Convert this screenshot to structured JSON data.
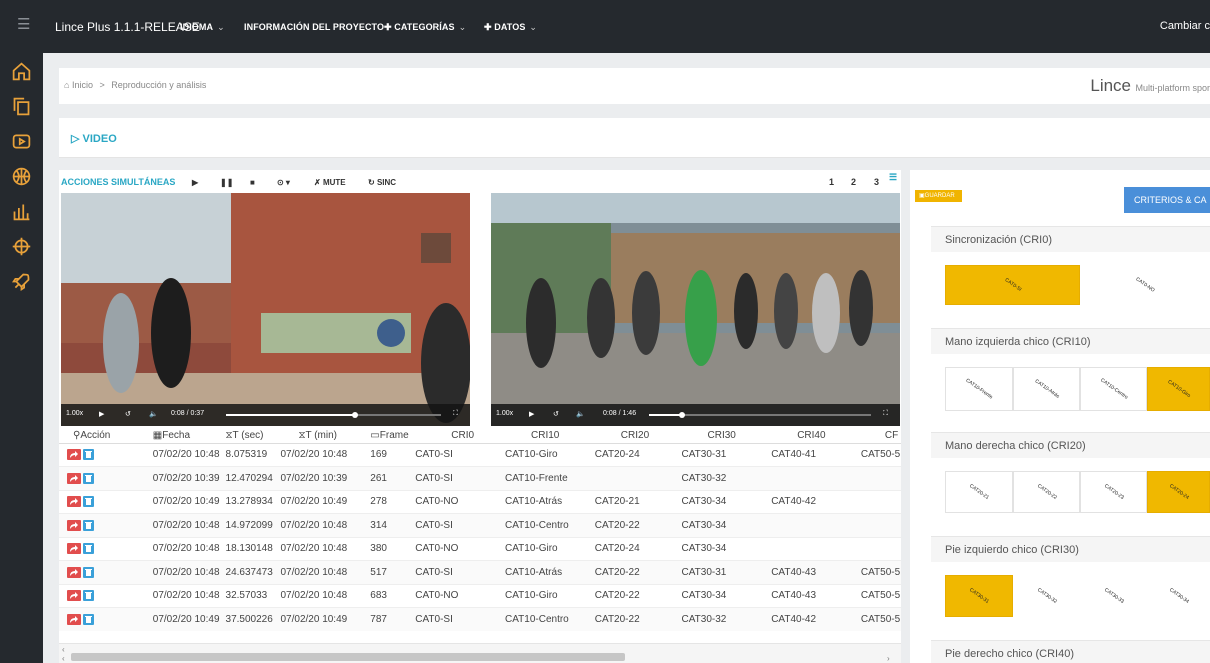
{
  "topbar": {
    "app_title": "Lince Plus 1.1.1-RELEASE",
    "menu": [
      "IDIOMA",
      "INFORMACIÓN DEL PROYECTO",
      "CATEGORÍAS",
      "DATOS"
    ],
    "right_text": "Cambiar c"
  },
  "sidebar": {
    "icons": [
      "home-icon",
      "copy-icon",
      "play-icon",
      "basketball-icon",
      "chart-icon",
      "crosshair-icon",
      "rocket-icon"
    ]
  },
  "breadcrumb": {
    "home": "Inicio",
    "separator": ">",
    "current": "Reproducción y análisis"
  },
  "brand": {
    "name": "Lince",
    "tagline": "Multi-platform spor"
  },
  "video_section": {
    "title": "VIDEO"
  },
  "toolbar": {
    "acciones": "ACCIONES SIMULTÁNEAS",
    "mute": "MUTE",
    "sinc": "SINC",
    "pages": [
      "1",
      "2",
      "3"
    ]
  },
  "players": [
    {
      "speed": "1.00x",
      "time": "0:08 / 0:37",
      "progress": 0.6
    },
    {
      "speed": "1.00x",
      "time": "0:08 / 1:46",
      "progress": 0.15
    }
  ],
  "table": {
    "headers": [
      "Acción",
      "Fecha",
      "T (sec)",
      "T (min)",
      "Frame",
      "CRI0",
      "CRI10",
      "CRI20",
      "CRI30",
      "CRI40",
      "CF"
    ],
    "rows": [
      [
        "07/02/20 10:48",
        "8.075319",
        "07/02/20 10:48",
        "169",
        "CAT0-SI",
        "CAT10-Giro",
        "CAT20-24",
        "CAT30-31",
        "CAT40-41",
        "CAT50-5"
      ],
      [
        "07/02/20 10:39",
        "12.470294",
        "07/02/20 10:39",
        "261",
        "CAT0-SI",
        "CAT10-Frente",
        "",
        "CAT30-32",
        "",
        ""
      ],
      [
        "07/02/20 10:49",
        "13.278934",
        "07/02/20 10:49",
        "278",
        "CAT0-NO",
        "CAT10-Atrás",
        "CAT20-21",
        "CAT30-34",
        "CAT40-42",
        ""
      ],
      [
        "07/02/20 10:48",
        "14.972099",
        "07/02/20 10:48",
        "314",
        "CAT0-SI",
        "CAT10-Centro",
        "CAT20-22",
        "CAT30-34",
        "",
        ""
      ],
      [
        "07/02/20 10:48",
        "18.130148",
        "07/02/20 10:48",
        "380",
        "CAT0-NO",
        "CAT10-Giro",
        "CAT20-24",
        "CAT30-34",
        "",
        ""
      ],
      [
        "07/02/20 10:48",
        "24.637473",
        "07/02/20 10:48",
        "517",
        "CAT0-SI",
        "CAT10-Atrás",
        "CAT20-22",
        "CAT30-31",
        "CAT40-43",
        "CAT50-5"
      ],
      [
        "07/02/20 10:48",
        "32.57033",
        "07/02/20 10:48",
        "683",
        "CAT0-NO",
        "CAT10-Giro",
        "CAT20-22",
        "CAT30-34",
        "CAT40-43",
        "CAT50-5"
      ],
      [
        "07/02/20 10:49",
        "37.500226",
        "07/02/20 10:49",
        "787",
        "CAT0-SI",
        "CAT10-Centro",
        "CAT20-22",
        "CAT30-32",
        "CAT40-42",
        "CAT50-5"
      ]
    ]
  },
  "right_panel": {
    "guardar": "GUARDAR",
    "criterios_button": "CRITERIOS & CA",
    "criteria": [
      {
        "title": "Sincronización (CRI0)",
        "cats": [
          "CAT0-SI",
          "CAT0-NO"
        ],
        "selected": 0
      },
      {
        "title": "Mano izquierda chico (CRI10)",
        "cats": [
          "CAT10-Frente",
          "CAT10-Atrás",
          "CAT10-Centro",
          "CAT10-Giro"
        ],
        "selected": 3
      },
      {
        "title": "Mano derecha chico (CRI20)",
        "cats": [
          "CAT20-21",
          "CAT20-22",
          "CAT20-23",
          "CAT20-24"
        ],
        "selected": 3
      },
      {
        "title": "Pie izquierdo chico (CRI30)",
        "cats": [
          "CAT30-31",
          "CAT30-32",
          "CAT30-33",
          "CAT30-34"
        ],
        "selected": 0
      },
      {
        "title": "Pie derecho chico (CRI40)",
        "cats": [],
        "selected": -1
      }
    ]
  },
  "colors": {
    "accent": "#2aa7c4",
    "selected": "#f0b800",
    "sidebar": "#25292e",
    "button_blue": "#4a8fd9",
    "button_red": "#e14d4d"
  }
}
